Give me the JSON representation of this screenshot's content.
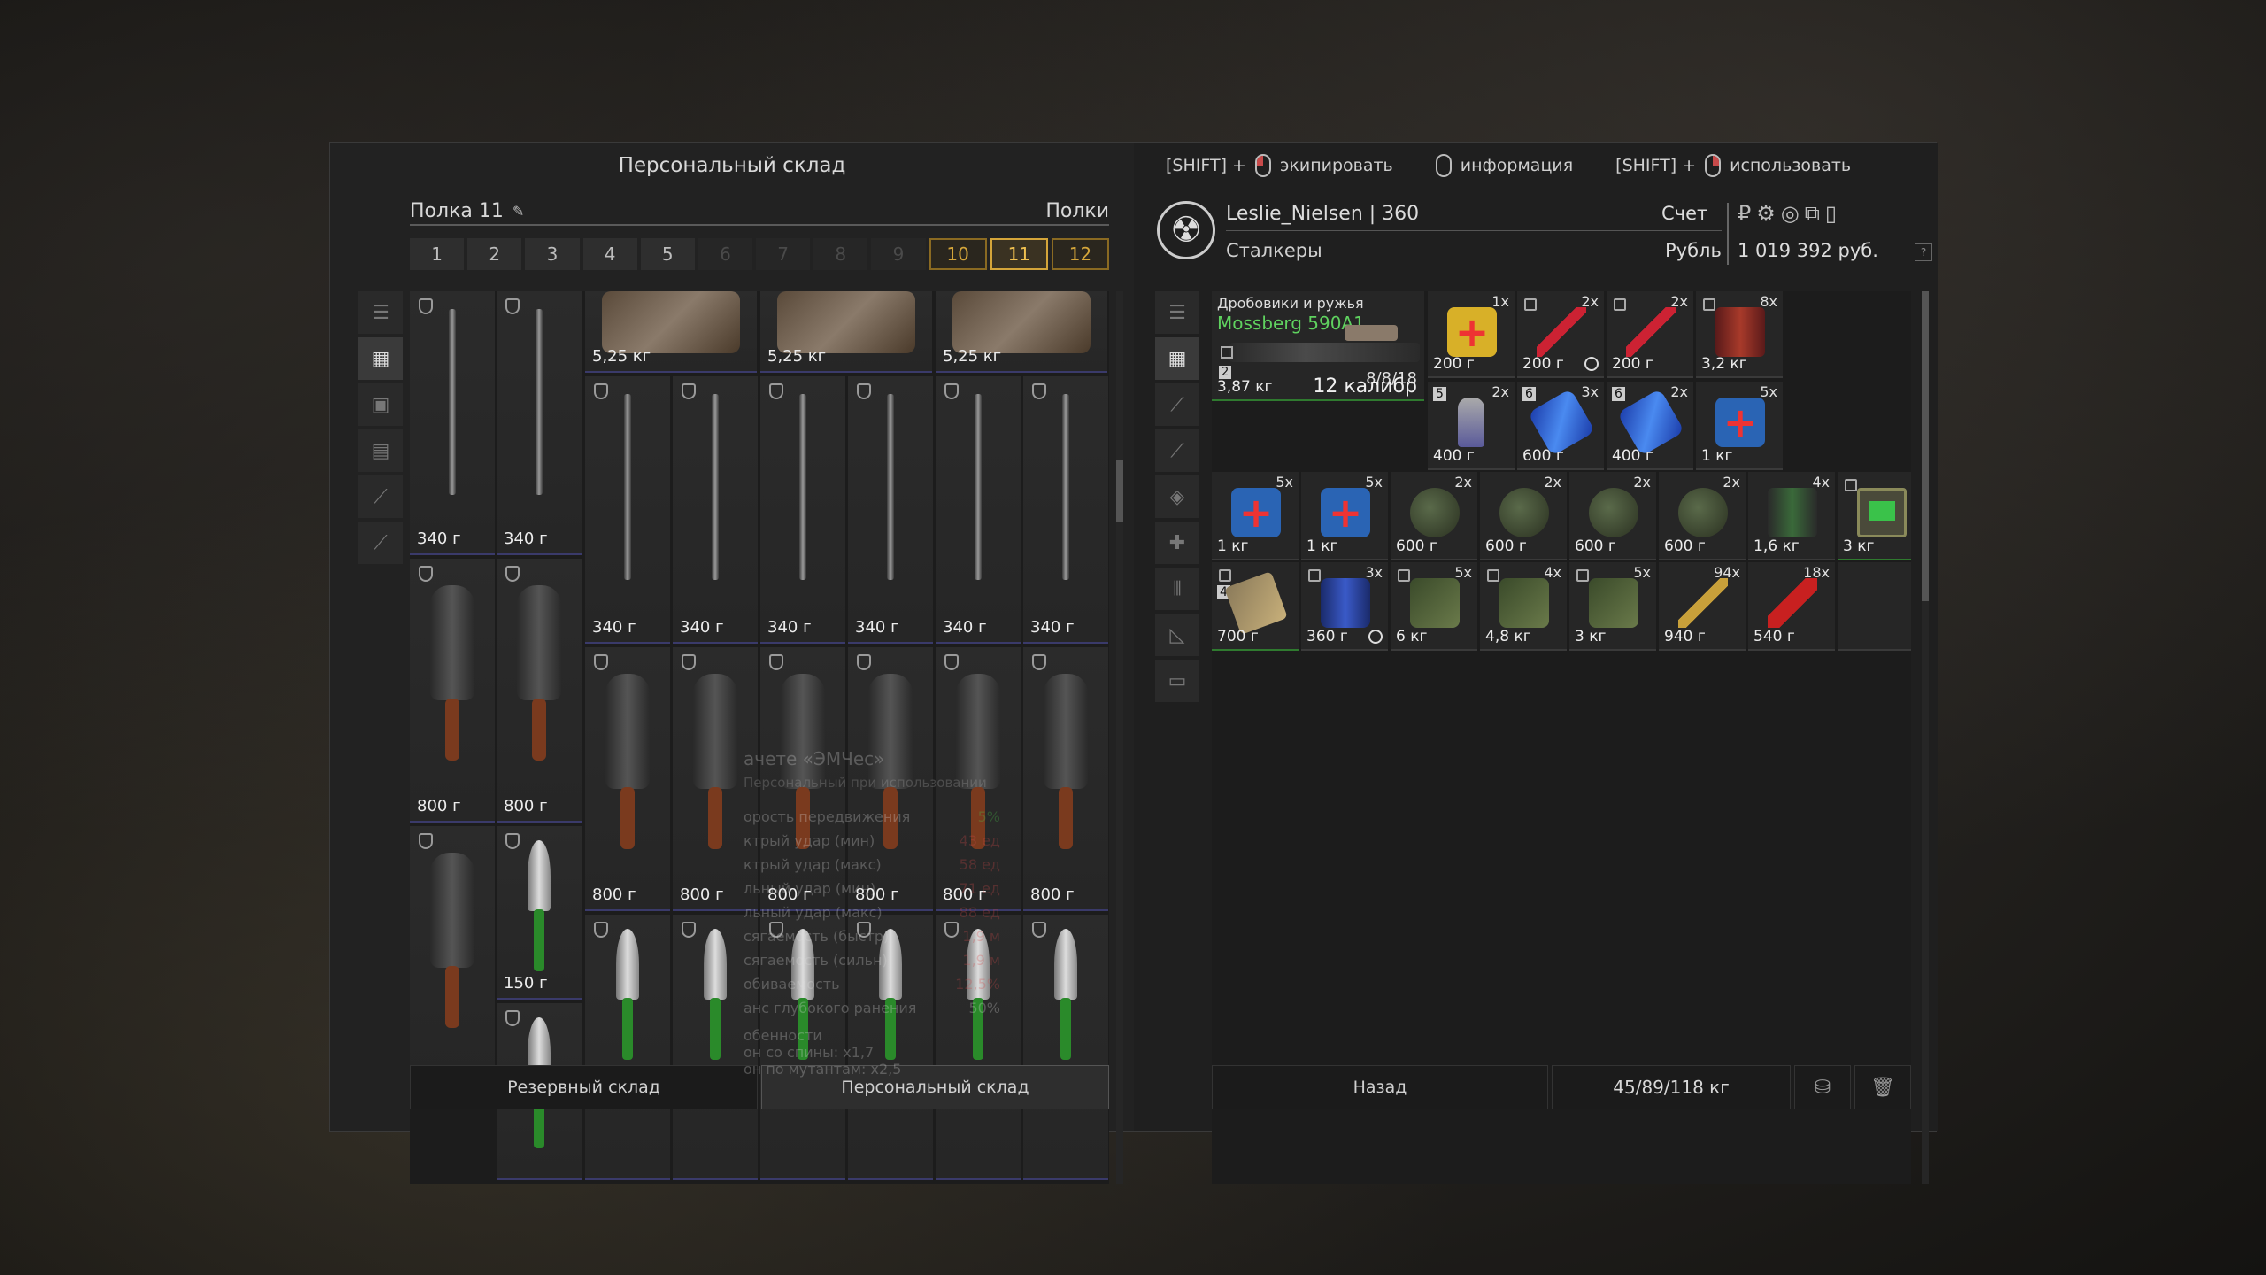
{
  "left": {
    "title": "Персональный склад",
    "shelf_name": "Полка 11",
    "shelves_label": "Полки",
    "tabs": [
      "1",
      "2",
      "3",
      "4",
      "5",
      "6",
      "7",
      "8",
      "9",
      "10",
      "11",
      "12"
    ],
    "bottom": {
      "reserve": "Резервный склад",
      "personal": "Персональный склад"
    },
    "weights": {
      "armor": "5,25 кг",
      "baton": "340 г",
      "machete": "800 г",
      "knife": "150 г"
    }
  },
  "right": {
    "hints": {
      "shift1": "[SHIFT] +",
      "equip": "экипировать",
      "info": "информация",
      "shift2": "[SHIFT] +",
      "use": "использовать"
    },
    "profile": {
      "name": "Leslie_Nielsen | 360",
      "faction": "Сталкеры",
      "account_label": "Счет",
      "currency_label": "Рубль",
      "money": "1 019 392 руб.",
      "ruble_sign": "₽"
    },
    "weapon": {
      "category": "Дробовики и ружья",
      "name": "Mossberg 590A1",
      "ammo": "8/8/18",
      "caliber": "12 калибр",
      "weight": "3,87 кг",
      "badge": "2"
    },
    "items": [
      {
        "q": "1x",
        "w": "200 г"
      },
      {
        "q": "2x",
        "w": "200 г"
      },
      {
        "q": "2x",
        "w": "200 г"
      },
      {
        "q": "8x",
        "w": "3,2 кг"
      },
      {
        "q": "2x",
        "w": "400 г",
        "badge": "5"
      },
      {
        "q": "3x",
        "w": "600 г",
        "badge": "6"
      },
      {
        "q": "2x",
        "w": "400 г",
        "badge": "6"
      },
      {
        "q": "5x",
        "w": "1 кг"
      },
      {
        "q": "5x",
        "w": "1 кг"
      },
      {
        "q": "5x",
        "w": "1 кг"
      },
      {
        "q": "2x",
        "w": "600 г"
      },
      {
        "q": "2x",
        "w": "600 г"
      },
      {
        "q": "2x",
        "w": "600 г"
      },
      {
        "q": "2x",
        "w": "600 г"
      },
      {
        "q": "4x",
        "w": "1,6 кг"
      },
      {
        "q": "",
        "w": "3 кг"
      },
      {
        "q": "",
        "w": "700 г",
        "badge": "4"
      },
      {
        "q": "3x",
        "w": "360 г"
      },
      {
        "q": "5x",
        "w": "6 кг"
      },
      {
        "q": "4x",
        "w": "4,8 кг"
      },
      {
        "q": "5x",
        "w": "3 кг"
      },
      {
        "q": "94x",
        "w": "940 г"
      },
      {
        "q": "18x",
        "w": "540 г"
      }
    ],
    "tooltip": {
      "title": "ачете «ЭМЧес»",
      "sub": "Персональный при использовании",
      "rows": [
        {
          "k": "орость передвижения",
          "v": "5%"
        },
        {
          "k": "ктрый удар (мин)",
          "v": "43 ед"
        },
        {
          "k": "ктрый удар (макс)",
          "v": "58 ед"
        },
        {
          "k": "льный удар (мин)",
          "v": "71 ед"
        },
        {
          "k": "льный удар (макс)",
          "v": "88 ед"
        },
        {
          "k": "сягаемость (быстр)",
          "v": "1,9 м"
        },
        {
          "k": "сягаемость (сильн)",
          "v": "1,9 м"
        },
        {
          "k": "обиваемость",
          "v": "12,5%"
        },
        {
          "k": "анс глубокого ранения",
          "v": "50%"
        }
      ],
      "features_title": "обенности",
      "features": [
        "он со спины: x1,7",
        "он по мутантам: x2,5"
      ]
    },
    "bottom": {
      "back": "Назад",
      "weight": "45/89/118 кг"
    }
  },
  "colors": {
    "accent": "#d4a53a",
    "weapon_name": "#5fd25f"
  }
}
